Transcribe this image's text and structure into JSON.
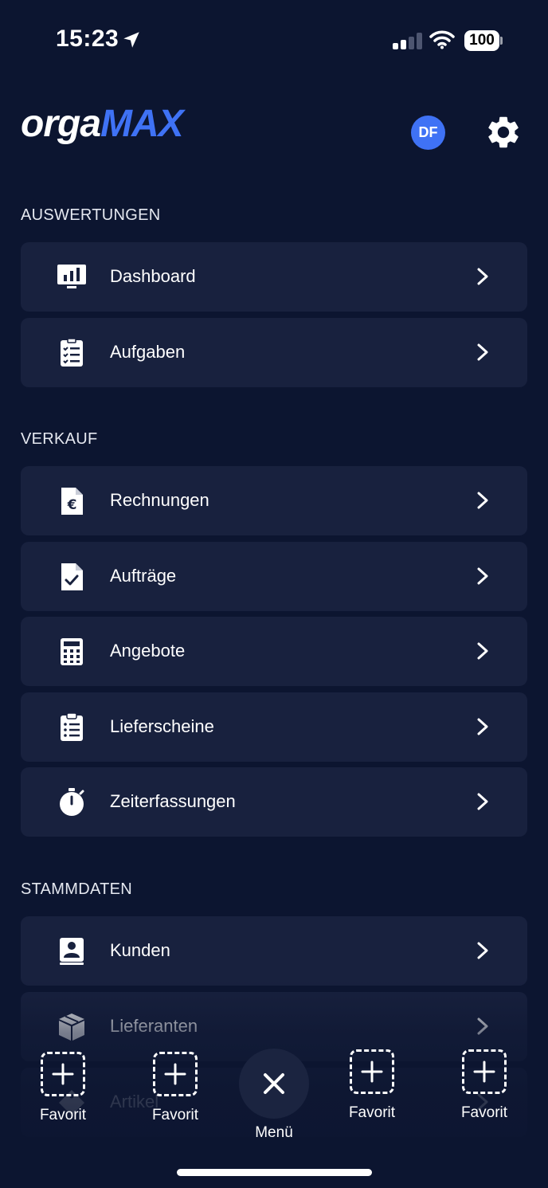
{
  "status_bar": {
    "time": "15:23",
    "battery": "100"
  },
  "header": {
    "logo_part1": "orga",
    "logo_part2": "MAX",
    "avatar_initials": "DF"
  },
  "colors": {
    "background": "#0c1530",
    "card": "#18213e",
    "accent": "#3f72f5"
  },
  "sections": [
    {
      "title": "AUSWERTUNGEN",
      "items": [
        {
          "label": "Dashboard",
          "icon": "dashboard-chart-icon"
        },
        {
          "label": "Aufgaben",
          "icon": "checklist-icon"
        }
      ]
    },
    {
      "title": "VERKAUF",
      "items": [
        {
          "label": "Rechnungen",
          "icon": "euro-document-icon"
        },
        {
          "label": "Aufträge",
          "icon": "check-document-icon"
        },
        {
          "label": "Angebote",
          "icon": "calculator-icon"
        },
        {
          "label": "Lieferscheine",
          "icon": "clipboard-list-icon"
        },
        {
          "label": "Zeiterfassungen",
          "icon": "stopwatch-icon"
        }
      ]
    },
    {
      "title": "STAMMDATEN",
      "items": [
        {
          "label": "Kunden",
          "icon": "contact-book-icon"
        },
        {
          "label": "Lieferanten",
          "icon": "box-icon"
        },
        {
          "label": "Artikel",
          "icon": "tag-icon"
        }
      ]
    }
  ],
  "bottom_bar": {
    "favorite_label": "Favorit",
    "menu_label": "Menü",
    "items": [
      {
        "label": "Favorit",
        "icon": "add-favorite-icon"
      },
      {
        "label": "Favorit",
        "icon": "add-favorite-icon"
      },
      {
        "label": "Menü",
        "icon": "close-icon"
      },
      {
        "label": "Favorit",
        "icon": "add-favorite-icon"
      },
      {
        "label": "Favorit",
        "icon": "add-favorite-icon"
      }
    ]
  }
}
